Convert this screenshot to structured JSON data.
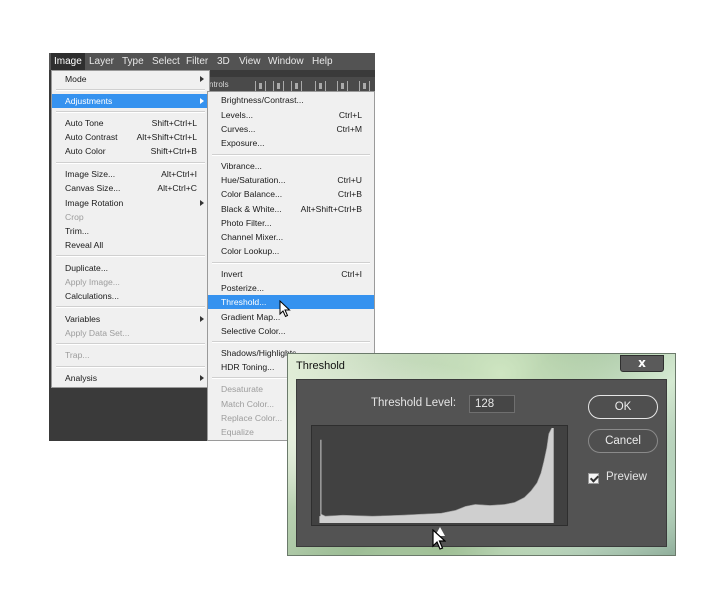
{
  "menubar": {
    "items": [
      "Image",
      "Layer",
      "Type",
      "Select",
      "Filter",
      "3D",
      "View",
      "Window",
      "Help"
    ],
    "options_fragment": "ntrols"
  },
  "image_menu": {
    "mode": "Mode",
    "adjustments": "Adjustments",
    "auto_tone": "Auto Tone",
    "auto_tone_sc": "Shift+Ctrl+L",
    "auto_contrast": "Auto Contrast",
    "auto_contrast_sc": "Alt+Shift+Ctrl+L",
    "auto_color": "Auto Color",
    "auto_color_sc": "Shift+Ctrl+B",
    "image_size": "Image Size...",
    "image_size_sc": "Alt+Ctrl+I",
    "canvas_size": "Canvas Size...",
    "canvas_size_sc": "Alt+Ctrl+C",
    "image_rotation": "Image Rotation",
    "crop": "Crop",
    "trim": "Trim...",
    "reveal_all": "Reveal All",
    "duplicate": "Duplicate...",
    "apply_image": "Apply Image...",
    "calculations": "Calculations...",
    "variables": "Variables",
    "apply_data_set": "Apply Data Set...",
    "trap": "Trap...",
    "analysis": "Analysis"
  },
  "adjustments_menu": {
    "brightness_contrast": "Brightness/Contrast...",
    "levels": "Levels...",
    "levels_sc": "Ctrl+L",
    "curves": "Curves...",
    "curves_sc": "Ctrl+M",
    "exposure": "Exposure...",
    "vibrance": "Vibrance...",
    "hue_saturation": "Hue/Saturation...",
    "hue_saturation_sc": "Ctrl+U",
    "color_balance": "Color Balance...",
    "color_balance_sc": "Ctrl+B",
    "black_white": "Black & White...",
    "black_white_sc": "Alt+Shift+Ctrl+B",
    "photo_filter": "Photo Filter...",
    "channel_mixer": "Channel Mixer...",
    "color_lookup": "Color Lookup...",
    "invert": "Invert",
    "invert_sc": "Ctrl+I",
    "posterize": "Posterize...",
    "threshold": "Threshold...",
    "gradient_map": "Gradient Map...",
    "selective_color": "Selective Color...",
    "shadows_highlights": "Shadows/Highlights...",
    "hdr_toning": "HDR Toning...",
    "desaturate": "Desaturate",
    "match_color": "Match Color...",
    "replace_color": "Replace Color...",
    "equalize": "Equalize"
  },
  "threshold_dialog": {
    "title": "Threshold",
    "close": "x",
    "level_label": "Threshold Level:",
    "level_value": "128",
    "level_fraction": 0.5,
    "ok": "OK",
    "cancel": "Cancel",
    "preview": "Preview",
    "preview_checked": true
  },
  "colors": {
    "menu_highlight": "#3592ef",
    "menu_bg": "#f0f0f0",
    "dialog_body": "#535353",
    "histogram_bg": "#414141",
    "histogram_fill": "#cfcfcf"
  }
}
